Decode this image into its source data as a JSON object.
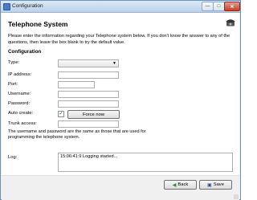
{
  "window": {
    "title": "Configuration"
  },
  "titlebar": {
    "minimize_glyph": "—",
    "maximize_glyph": "□",
    "close_glyph": "✕"
  },
  "page": {
    "heading": "Telephone System",
    "intro": "Please enter the information regarding your Telephone system below. If you don't know the answer to any of the questions, then leave the box blank to try the default value.",
    "section_title": "Configuration"
  },
  "form": {
    "type_label": "Type:",
    "type_value": "",
    "ip_label": "IP address:",
    "ip_value": "",
    "port_label": "Port:",
    "port_value": "",
    "username_label": "Username:",
    "username_value": "",
    "password_label": "Password:",
    "password_value": "",
    "autocreate_label": "Auto create:",
    "autocreate_checked": true,
    "force_now_label": "Force now",
    "trunk_label": "Trunk access:",
    "trunk_value": "",
    "note": "The username and password are the same as those that are used for programming the telephone system."
  },
  "log": {
    "label": "Log:",
    "entry": "15:06:41:9   Logging started..."
  },
  "footer": {
    "back_label": "Back",
    "save_label": "Save"
  },
  "icons": {
    "app": "gear-icon",
    "brand": "telephone-icon",
    "back": "back-arrow-icon",
    "save": "floppy-disk-icon"
  },
  "colors": {
    "close_button": "#c5412a",
    "titlebar": "#bcd2ea"
  }
}
